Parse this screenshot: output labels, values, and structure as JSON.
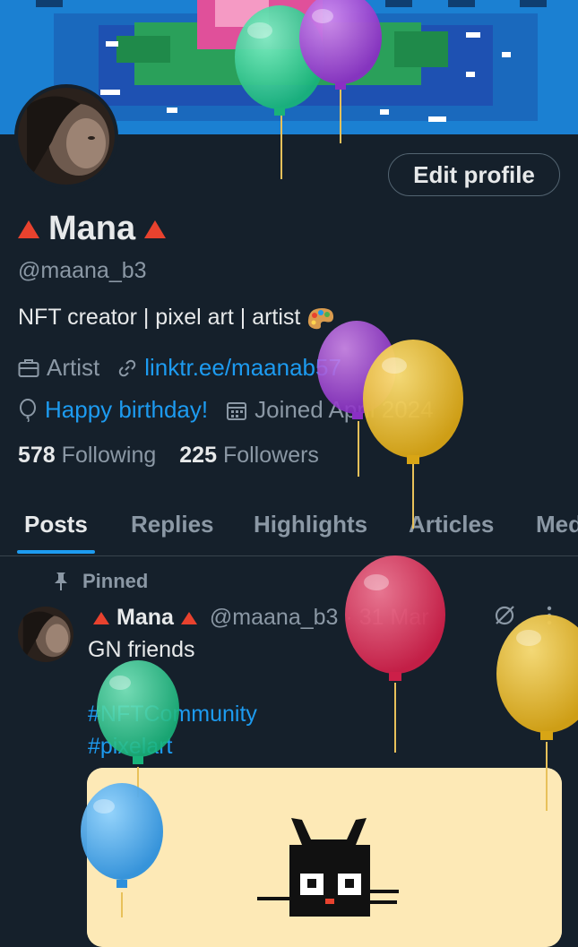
{
  "profile": {
    "name": "Mana",
    "handle": "@maana_b3",
    "bio": "NFT creator | pixel art | artist",
    "bio_emoji_icon": "artist-palette-icon",
    "edit_button": "Edit profile",
    "profession": "Artist",
    "link": "linktr.ee/maanab57",
    "birthday": "Happy birthday!",
    "joined": "Joined April 2024",
    "following_count": "578",
    "following_label": "Following",
    "followers_count": "225",
    "followers_label": "Followers"
  },
  "tabs": [
    {
      "label": "Posts",
      "active": true
    },
    {
      "label": "Replies",
      "active": false
    },
    {
      "label": "Highlights",
      "active": false
    },
    {
      "label": "Articles",
      "active": false
    },
    {
      "label": "Media",
      "active": false
    }
  ],
  "pinned_post": {
    "pinned_label": "Pinned",
    "author": "Mana",
    "handle": "@maana_b3",
    "date": "· 31 Mar",
    "text": "GN friends",
    "hashtags": [
      "#NFTCommunity",
      "#pixelart"
    ]
  },
  "colors": {
    "background": "#15202b",
    "accent": "#1d9bf0",
    "banner": "#1b7fd0",
    "triangle": "#e8422e"
  }
}
